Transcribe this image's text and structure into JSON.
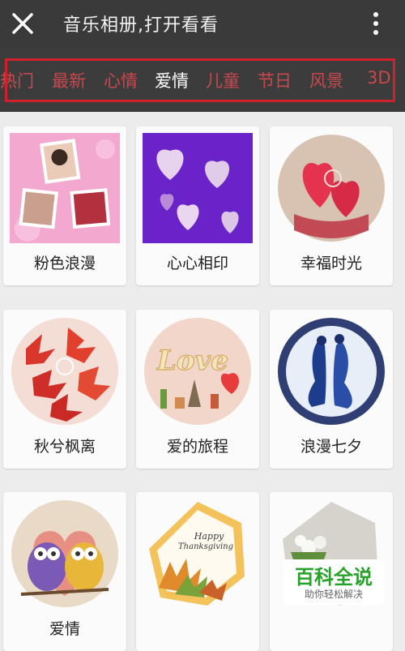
{
  "header": {
    "title": "音乐相册,打开看看"
  },
  "tabs": [
    {
      "label": "热门"
    },
    {
      "label": "最新"
    },
    {
      "label": "心情"
    },
    {
      "label": "爱情"
    },
    {
      "label": "儿童"
    },
    {
      "label": "节日"
    },
    {
      "label": "风景"
    },
    {
      "label": "3D"
    }
  ],
  "active_tab": "爱情",
  "cards": [
    {
      "label": "粉色浪漫"
    },
    {
      "label": "心心相印"
    },
    {
      "label": "幸福时光"
    },
    {
      "label": "秋兮枫离"
    },
    {
      "label": "爱的旅程"
    },
    {
      "label": "浪漫七夕"
    },
    {
      "label": "爱情"
    },
    {
      "label": ""
    },
    {
      "label": ""
    }
  ],
  "thumb_text": {
    "love": "Love",
    "thanks_1": "Happy",
    "thanks_2": "Thanksgiving"
  },
  "watermark": {
    "title": "百科全说",
    "subtitle": "助你轻松解决"
  },
  "colors": {
    "topbar": "#3a3a3a",
    "tab_text": "#c9484e",
    "tab_active": "#ffffff",
    "highlight_box": "#d0202a",
    "page_bg": "#ececec"
  }
}
